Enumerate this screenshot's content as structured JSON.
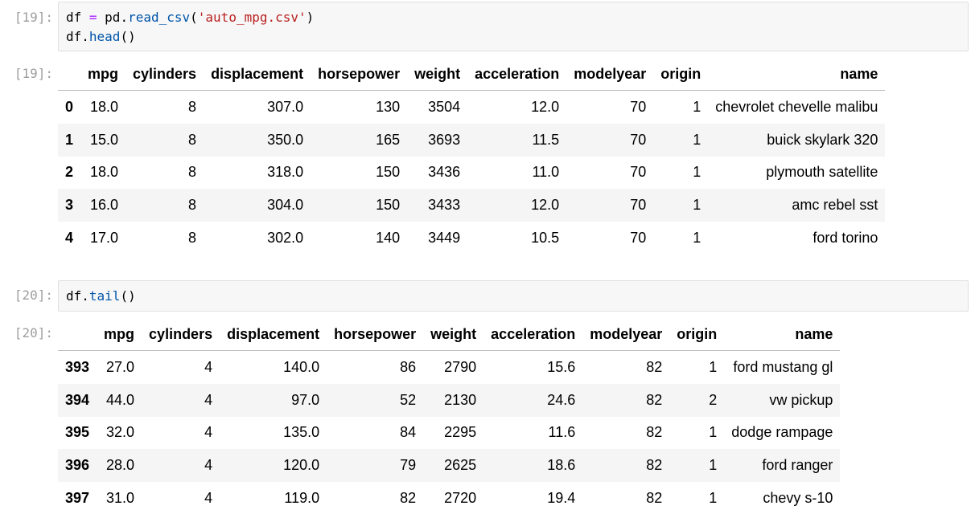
{
  "cells": [
    {
      "in_prompt": "[19]:",
      "out_prompt": "[19]:",
      "code_line1": {
        "a": "df",
        "op": " = ",
        "b": "pd.",
        "fn": "read_csv",
        "p1": "(",
        "str": "'auto_mpg.csv'",
        "p2": ")"
      },
      "code_line2": {
        "a": "df.",
        "fn": "head",
        "p": "()"
      },
      "columns": [
        "mpg",
        "cylinders",
        "displacement",
        "horsepower",
        "weight",
        "acceleration",
        "modelyear",
        "origin",
        "name"
      ],
      "rows": [
        {
          "idx": "0",
          "vals": [
            "18.0",
            "8",
            "307.0",
            "130",
            "3504",
            "12.0",
            "70",
            "1",
            "chevrolet chevelle malibu"
          ]
        },
        {
          "idx": "1",
          "vals": [
            "15.0",
            "8",
            "350.0",
            "165",
            "3693",
            "11.5",
            "70",
            "1",
            "buick skylark 320"
          ]
        },
        {
          "idx": "2",
          "vals": [
            "18.0",
            "8",
            "318.0",
            "150",
            "3436",
            "11.0",
            "70",
            "1",
            "plymouth satellite"
          ]
        },
        {
          "idx": "3",
          "vals": [
            "16.0",
            "8",
            "304.0",
            "150",
            "3433",
            "12.0",
            "70",
            "1",
            "amc rebel sst"
          ]
        },
        {
          "idx": "4",
          "vals": [
            "17.0",
            "8",
            "302.0",
            "140",
            "3449",
            "10.5",
            "70",
            "1",
            "ford torino"
          ]
        }
      ]
    },
    {
      "in_prompt": "[20]:",
      "out_prompt": "[20]:",
      "code_line1": {
        "a": "df.",
        "fn": "tail",
        "p": "()"
      },
      "columns": [
        "mpg",
        "cylinders",
        "displacement",
        "horsepower",
        "weight",
        "acceleration",
        "modelyear",
        "origin",
        "name"
      ],
      "rows": [
        {
          "idx": "393",
          "vals": [
            "27.0",
            "4",
            "140.0",
            "86",
            "2790",
            "15.6",
            "82",
            "1",
            "ford mustang gl"
          ]
        },
        {
          "idx": "394",
          "vals": [
            "44.0",
            "4",
            "97.0",
            "52",
            "2130",
            "24.6",
            "82",
            "2",
            "vw pickup"
          ]
        },
        {
          "idx": "395",
          "vals": [
            "32.0",
            "4",
            "135.0",
            "84",
            "2295",
            "11.6",
            "82",
            "1",
            "dodge rampage"
          ]
        },
        {
          "idx": "396",
          "vals": [
            "28.0",
            "4",
            "120.0",
            "79",
            "2625",
            "18.6",
            "82",
            "1",
            "ford ranger"
          ]
        },
        {
          "idx": "397",
          "vals": [
            "31.0",
            "4",
            "119.0",
            "82",
            "2720",
            "19.4",
            "82",
            "1",
            "chevy s-10"
          ]
        }
      ]
    }
  ]
}
